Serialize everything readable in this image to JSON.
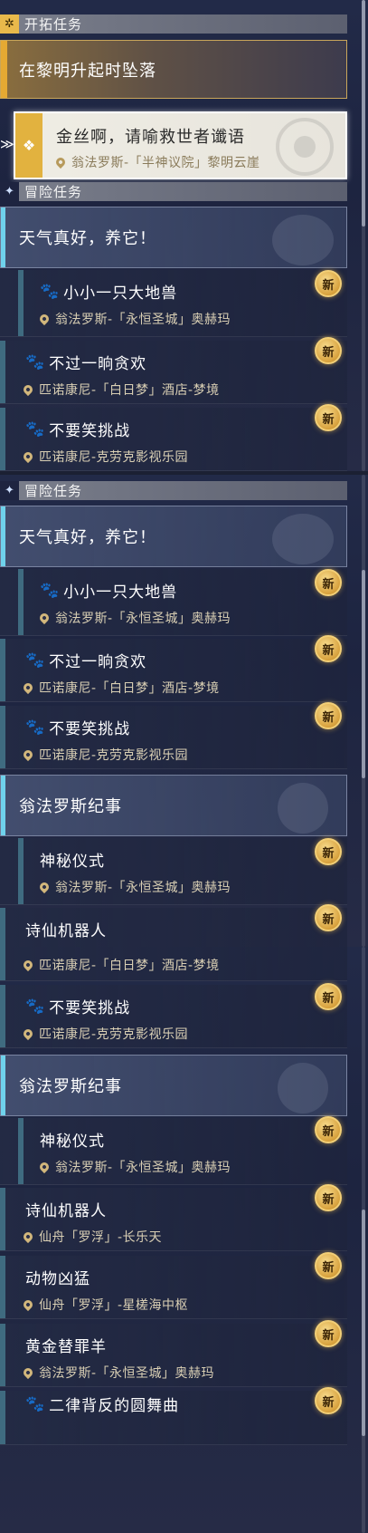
{
  "trailblaze": {
    "header": "开拓任务",
    "banner": "在黎明升起时坠落",
    "selected": {
      "title": "金丝啊，请喻救世者谶语",
      "location": "翁法罗斯-「半神议院」黎明云崖"
    }
  },
  "adventure_header": "冒险任务",
  "new_label": "新",
  "panel1": {
    "tile": "天气真好，养它！",
    "quests": [
      {
        "title": "小小一只大地兽",
        "location": "翁法罗斯-「永恒圣城」奥赫玛"
      },
      {
        "title": "不过一晌贪欢",
        "location": "匹诺康尼-「白日梦」酒店-梦境"
      },
      {
        "title": "不要笑挑战",
        "location": "匹诺康尼-克劳克影视乐园"
      }
    ]
  },
  "panel2": {
    "tile1": "天气真好，养它！",
    "quests1": [
      {
        "title": "小小一只大地兽",
        "location": "翁法罗斯-「永恒圣城」奥赫玛"
      },
      {
        "title": "不过一晌贪欢",
        "location": "匹诺康尼-「白日梦」酒店-梦境"
      },
      {
        "title": "不要笑挑战",
        "location": "匹诺康尼-克劳克影视乐园"
      }
    ],
    "tile2": "翁法罗斯纪事",
    "quest_mysterious": {
      "title": "神秘仪式",
      "location": "翁法罗斯-「永恒圣城」奥赫玛"
    },
    "quest_poet_title": "诗仙机器人"
  },
  "panel3": {
    "partial_location": "匹诺康尼-「白日梦」酒店-梦境",
    "quest_laugh": {
      "title": "不要笑挑战",
      "location": "匹诺康尼-克劳克影视乐园"
    },
    "tile": "翁法罗斯纪事",
    "quests": [
      {
        "title": "神秘仪式",
        "location": "翁法罗斯-「永恒圣城」奥赫玛"
      },
      {
        "title": "诗仙机器人",
        "location": "仙舟「罗浮」-长乐天"
      },
      {
        "title": "动物凶猛",
        "location": "仙舟「罗浮」-星槎海中枢"
      },
      {
        "title": "黄金替罪羊",
        "location": "翁法罗斯-「永恒圣城」奥赫玛"
      }
    ],
    "cut_title": "二律背反的圆舞曲"
  },
  "colors": {
    "accent_cyan": "#6fd2ec",
    "trail_gold": "#e5a933",
    "badge_gold": "#d8a23e"
  }
}
